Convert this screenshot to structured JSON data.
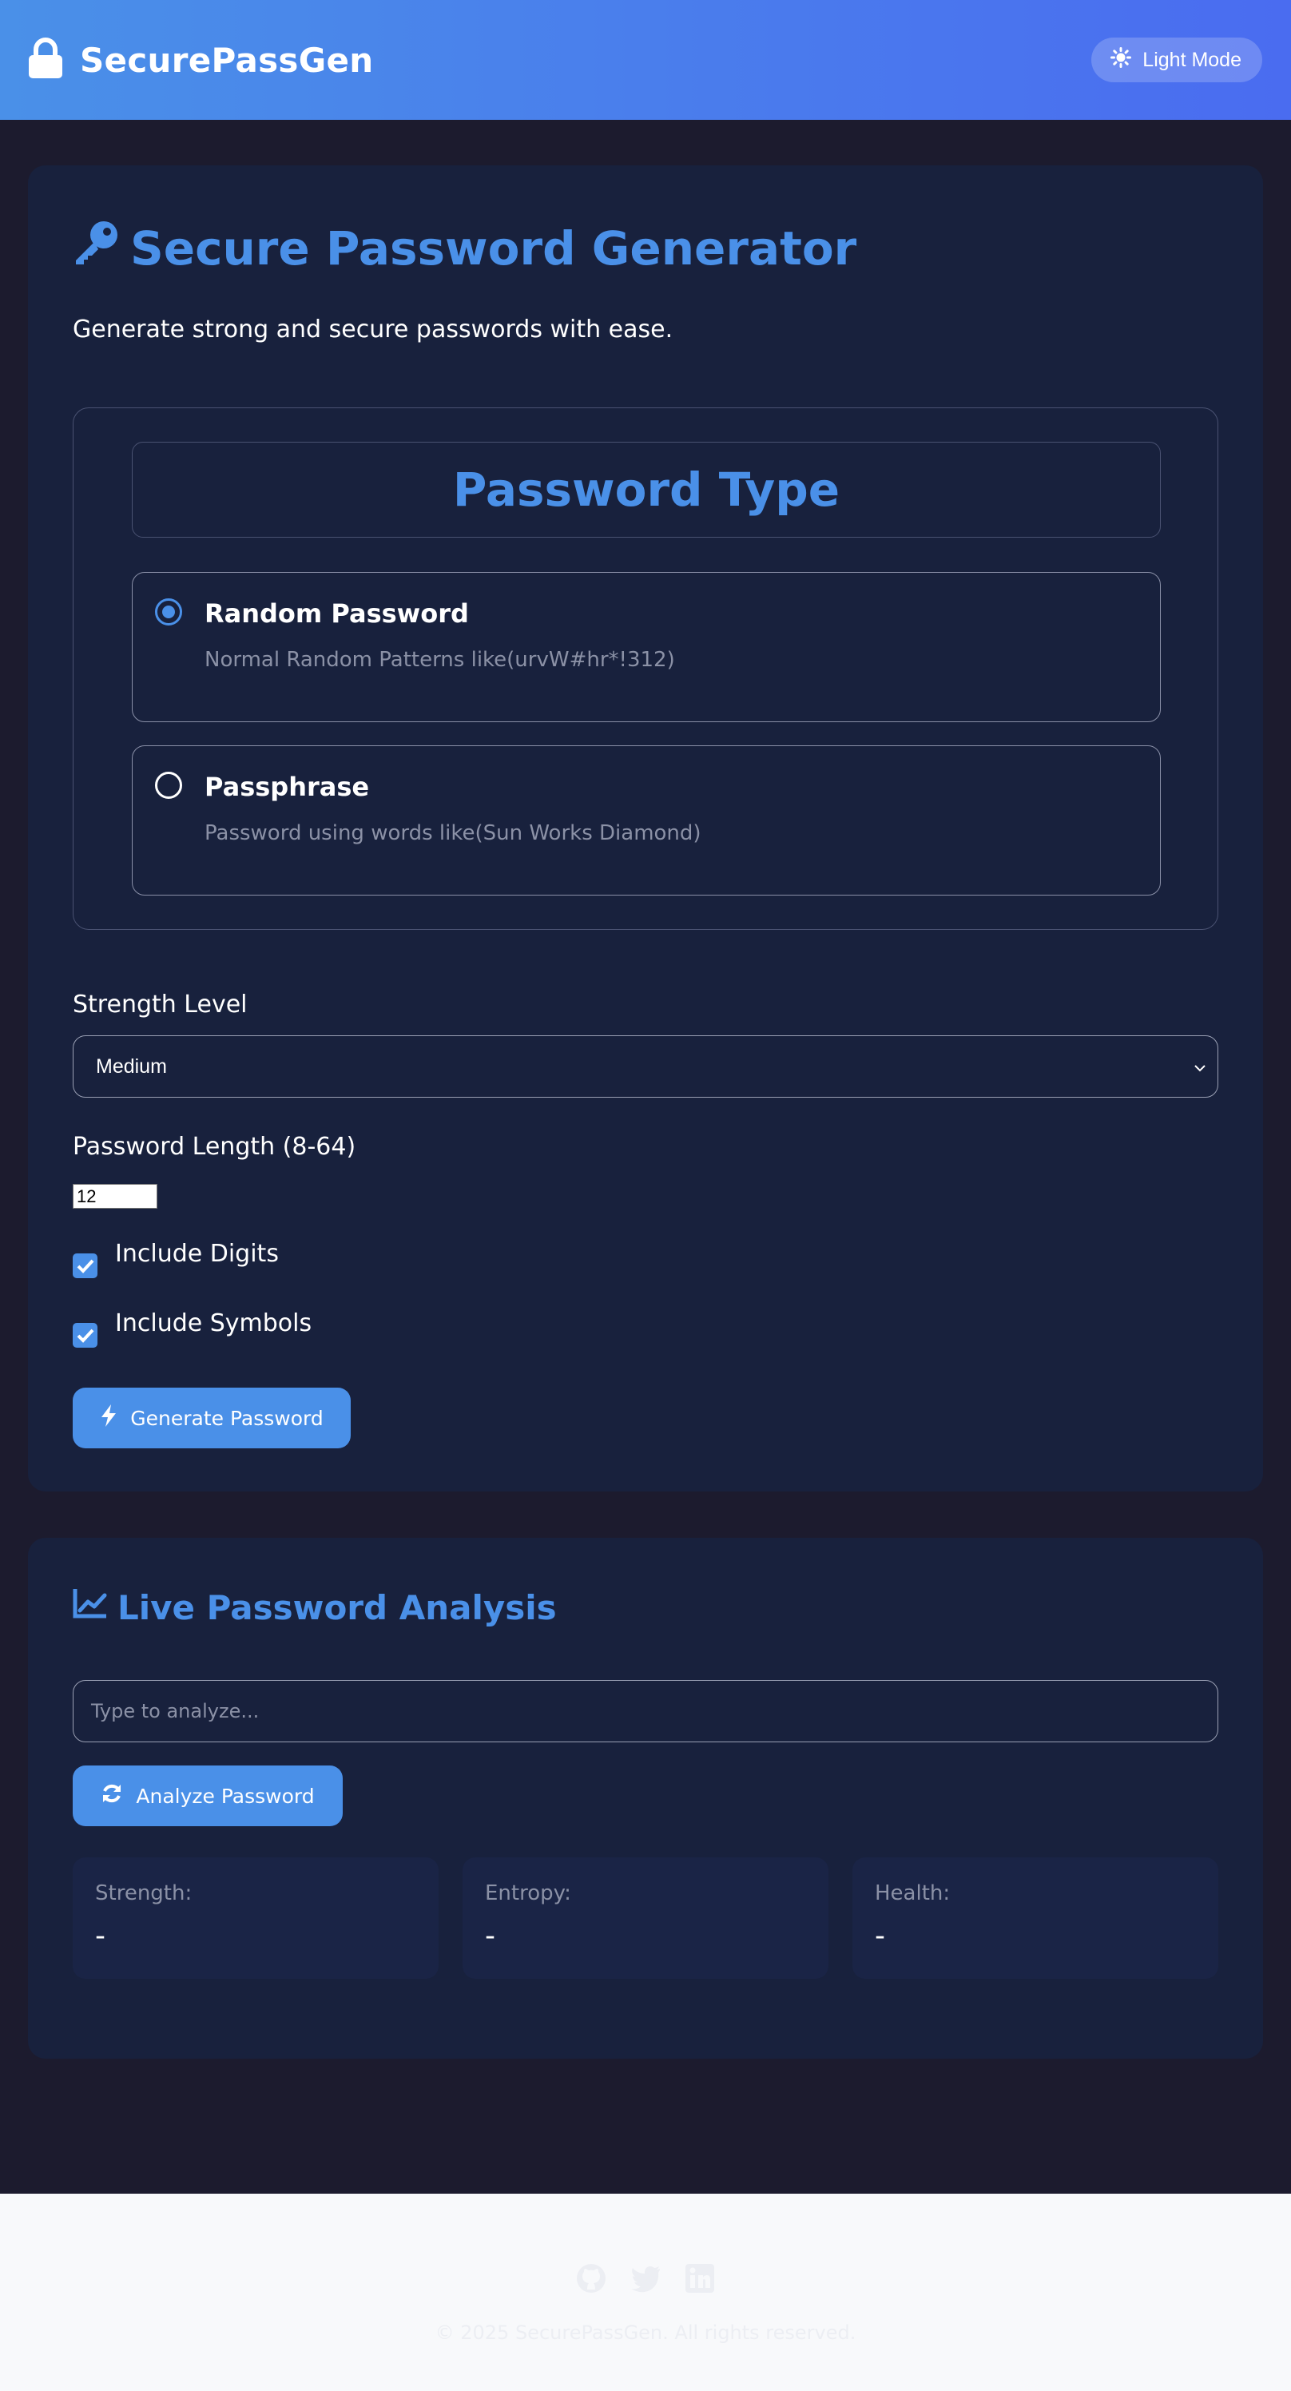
{
  "colors": {
    "accent": "#4a90e8",
    "background": "#1c1b2e",
    "card": "#18213d",
    "muted_text": "#8b91a6",
    "footer": "#f8f9fb"
  },
  "navbar": {
    "brand_icon": "lock-icon",
    "brand": "SecurePassGen",
    "theme_icon": "sun-icon",
    "theme_toggle": "Light Mode"
  },
  "generator": {
    "title_icon": "key-icon",
    "title": "Secure Password Generator",
    "subtitle": "Generate strong and secure passwords with ease.",
    "type_legend": "Password Type",
    "options": [
      {
        "title": "Random Password",
        "description": "Normal Random Patterns like(urvW#hr*!312)",
        "checked": true
      },
      {
        "title": "Passphrase",
        "description": "Password using words like(Sun Works Diamond)",
        "checked": false
      }
    ],
    "strength_label": "Strength Level",
    "strength_value": "Medium",
    "length_label": "Password Length (8-64)",
    "length_value": "12",
    "include_digits": "Include Digits",
    "include_symbols": "Include Symbols",
    "generate_icon": "bolt-icon",
    "generate_button": "Generate Password"
  },
  "analysis": {
    "title_icon": "chart-line-icon",
    "title": "Live Password Analysis",
    "placeholder": "Type to analyze...",
    "analyze_icon": "refresh-icon",
    "analyze_button": "Analyze Password",
    "stats": [
      {
        "label": "Strength:",
        "value": "-"
      },
      {
        "label": "Entropy:",
        "value": "-"
      },
      {
        "label": "Health:",
        "value": "-"
      }
    ]
  },
  "footer": {
    "social_icons": [
      "github-icon",
      "twitter-icon",
      "linkedin-icon"
    ],
    "copyright": "© 2025 SecurePassGen. All rights reserved."
  }
}
